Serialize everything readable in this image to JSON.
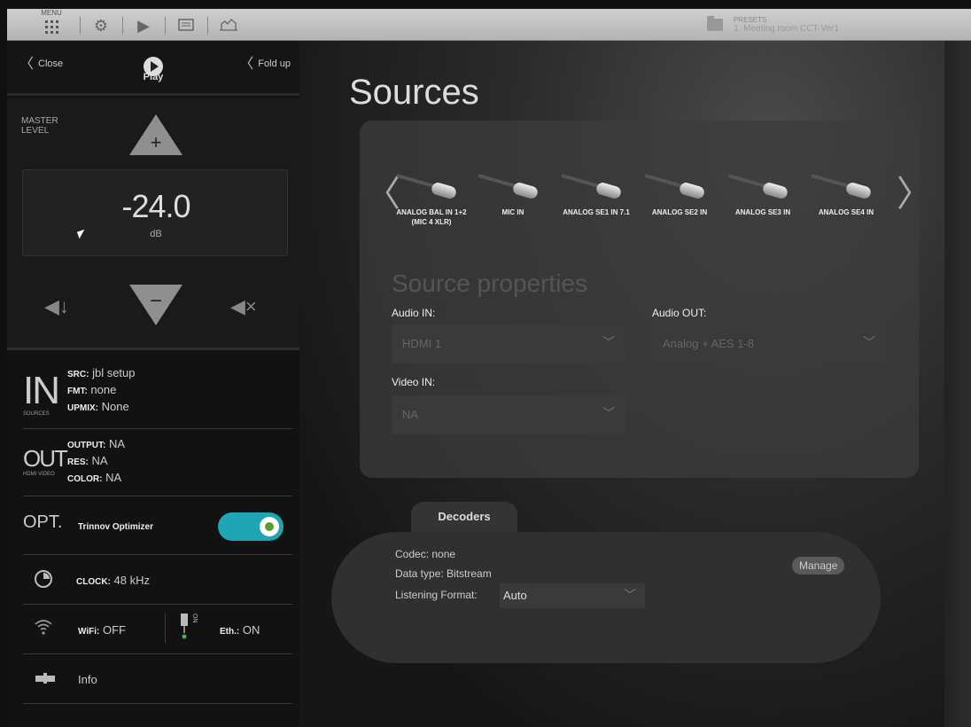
{
  "topbar": {
    "menu_label": "MENU",
    "icons": [
      "settings-icon",
      "play-icon",
      "screen-icon",
      "room-icon"
    ],
    "presets_label": "PRESETS",
    "presets_value": "1. Meeting room CCT-Ver1"
  },
  "left_panel": {
    "close_label": "Close",
    "fold_label": "Fold up",
    "logo_text": "Play",
    "master_label": "MASTER LEVEL",
    "level_value": "-24.0",
    "level_unit": "dB",
    "in": {
      "letter": "IN",
      "caption": "SOURCES",
      "src_key": "SRC:",
      "src_val": "jbl setup",
      "fmt_key": "FMT:",
      "fmt_val": "none",
      "upmix_key": "UPMIX:",
      "upmix_val": "None"
    },
    "out": {
      "letter": "OUT",
      "caption": "HDMI VIDEO",
      "output_key": "OUTPUT:",
      "output_val": "NA",
      "res_key": "RES:",
      "res_val": "NA",
      "color_key": "COLOR:",
      "color_val": "NA"
    },
    "opt": {
      "letter": "OPT.",
      "label": "Trinnov Optimizer",
      "toggle_on": true,
      "accent": "#1fa5b3"
    },
    "clock": {
      "key": "CLOCK:",
      "val": "48 kHz"
    },
    "network": {
      "wifi_key": "WiFi:",
      "wifi_val": "OFF",
      "eth_badge": "ON",
      "eth_key": "Eth.:",
      "eth_val": "ON"
    },
    "info_label": "Info"
  },
  "main": {
    "title": "Sources",
    "sources": [
      "ANALOG BAL IN 1+2 (MIC 4 XLR)",
      "MIC IN",
      "ANALOG SE1 IN 7.1",
      "ANALOG SE2 IN",
      "ANALOG SE3 IN",
      "ANALOG SE4 IN"
    ],
    "props_title": "Source properties",
    "audio_in_label": "Audio IN:",
    "audio_in_value": "HDMI 1",
    "audio_out_label": "Audio OUT:",
    "audio_out_value": "Analog + AES 1-8",
    "video_in_label": "Video IN:",
    "video_in_value": "NA",
    "decoders": {
      "tab_label": "Decoders",
      "codec": "Codec: none",
      "data_type": "Data type: Bitstream",
      "lf_label": "Listening Format:",
      "lf_value": "Auto",
      "manage_label": "Manage"
    }
  }
}
